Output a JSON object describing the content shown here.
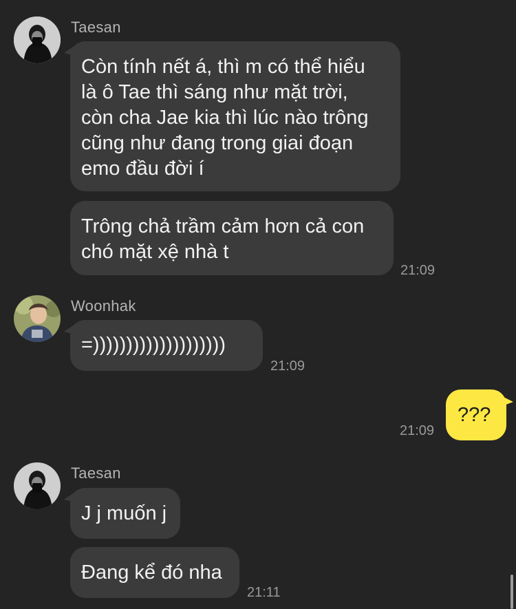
{
  "messages": {
    "g1": {
      "sender": "Taesan",
      "m1": "Còn tính nết á, thì m có thể hiểu\nlà ô Tae thì sáng như mặt trời,\ncòn cha Jae kia thì lúc nào trông\ncũng như đang trong giai đoạn\nemo đầu đời í",
      "m2": "Trông chả trầm cảm hơn cả con\nchó mặt xệ nhà t",
      "time": "21:09"
    },
    "g2": {
      "sender": "Woonhak",
      "m1": "=))))))))))))))))))))",
      "time": "21:09"
    },
    "mine": {
      "m1": "???",
      "time": "21:09"
    },
    "g3": {
      "sender": "Taesan",
      "m1": "J j muốn j",
      "m2": "Đang kể đó nha",
      "time": "21:11"
    }
  },
  "colors": {
    "background": "#242424",
    "bubble_other": "#3b3b3b",
    "bubble_mine": "#fde843"
  }
}
